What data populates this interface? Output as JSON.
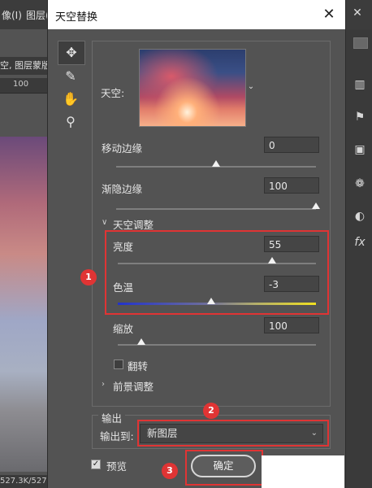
{
  "app": {
    "menu": [
      "像(I)",
      "图层(L)"
    ],
    "doc_tab": "空, 图层蒙版",
    "ruler_value": "100",
    "status": "527.3K/527"
  },
  "dialog": {
    "title": "天空替换",
    "close_icon": "close-icon",
    "tools": [
      "move-tool-icon",
      "sky-brush-icon",
      "hand-tool-icon",
      "zoom-tool-icon"
    ],
    "sky_label": "天空:",
    "move_edge_label": "移动边缘",
    "move_edge_value": "0",
    "move_edge_level": 0.5,
    "fade_edge_label": "渐隐边缘",
    "fade_edge_value": "100",
    "fade_edge_level": 1.0,
    "sky_adjust_label": "天空调整",
    "brightness_label": "亮度",
    "brightness_value": "55",
    "brightness_level": 0.78,
    "temperature_label": "色温",
    "temperature_value": "-3",
    "temperature_level": 0.47,
    "scale_label": "缩放",
    "scale_value": "100",
    "scale_level": 0.12,
    "flip_label": "翻转",
    "foreground_label": "前景调整",
    "output_group_label": "输出",
    "output_to_label": "输出到:",
    "output_to_value": "新图层",
    "preview_label": "预览",
    "ok_label": "确定",
    "badges": [
      "1",
      "2",
      "3"
    ]
  },
  "colors": {
    "highlight": "#e03434",
    "panel_bg": "#535353"
  }
}
